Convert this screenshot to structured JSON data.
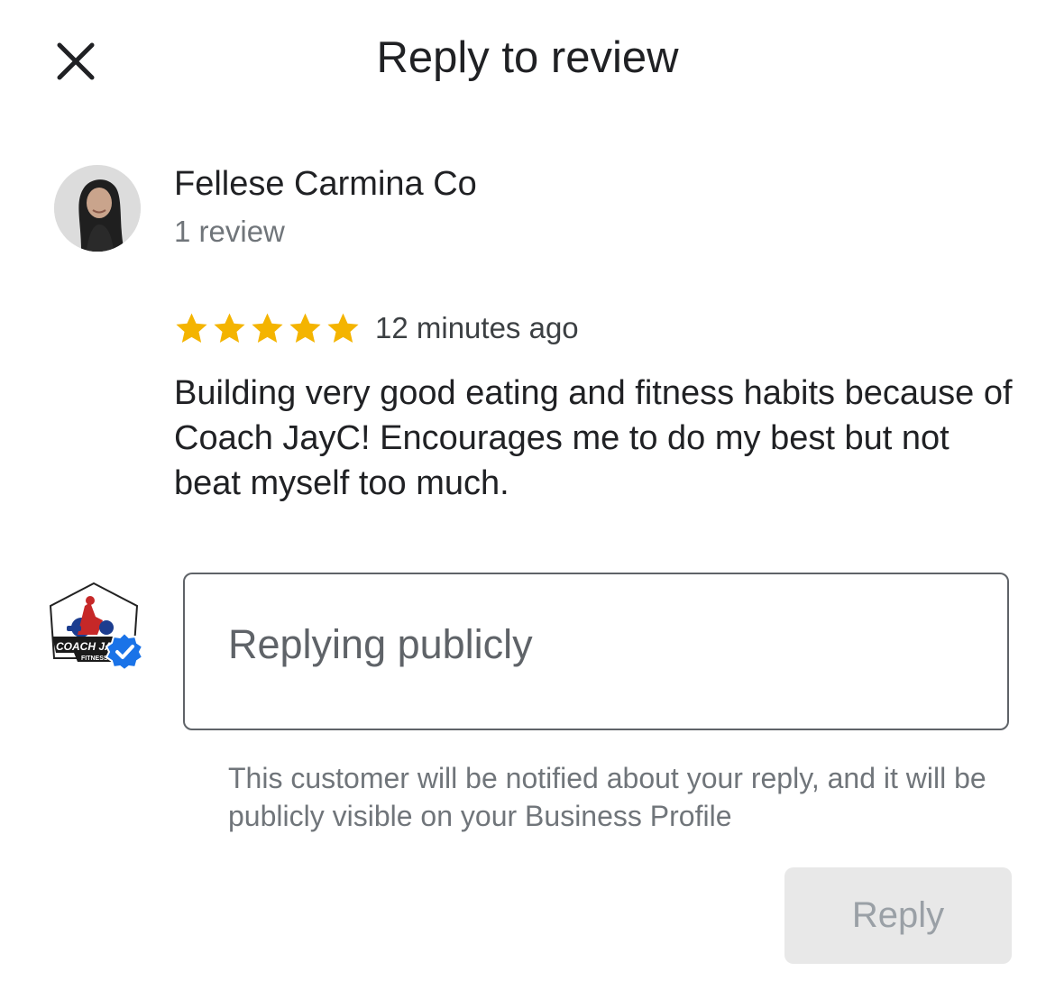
{
  "header": {
    "title": "Reply to review",
    "close_icon": "close-icon"
  },
  "review": {
    "reviewer_name": "Fellese Carmina Co",
    "review_count": "1 review",
    "rating": 5,
    "rating_max": 5,
    "star_color": "#f4b400",
    "timestamp": "12 minutes ago",
    "text": "Building very good eating and fitness habits because of Coach JayC! Encourages me to do my best but not beat myself too much."
  },
  "reply": {
    "placeholder": "Replying publicly",
    "value": "",
    "business_logo_text": "COACH JAYC",
    "business_logo_subtext": "FITNESS",
    "verified_badge_color": "#1a73e8",
    "helper_text": "This customer will be notified about your reply, and it will be publicly visible on your Business Profile",
    "button_label": "Reply"
  }
}
